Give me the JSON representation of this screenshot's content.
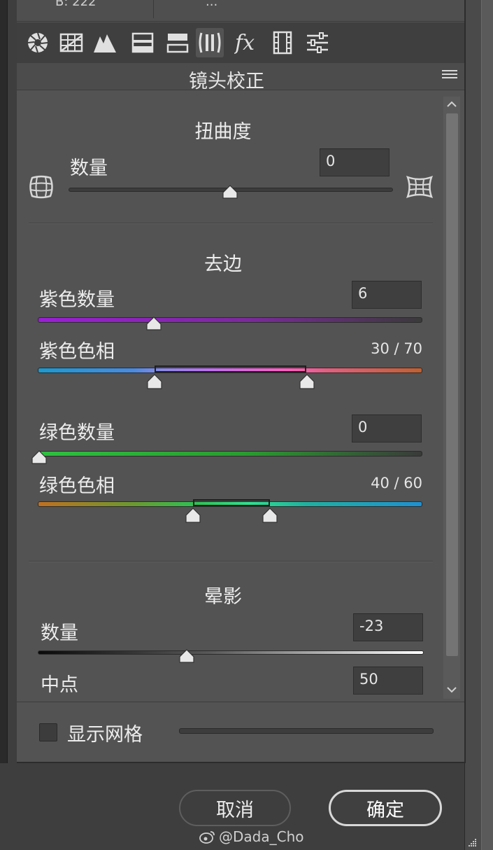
{
  "top_partial": {
    "left_text": "B: 222",
    "right_text": "..."
  },
  "header": {
    "title": "镜头校正"
  },
  "tabs": [
    {
      "icon": "aperture-icon"
    },
    {
      "icon": "grid-icon"
    },
    {
      "icon": "mountain-icon"
    },
    {
      "icon": "split-tone-icon"
    },
    {
      "icon": "hsl-icon"
    },
    {
      "icon": "lens-correction-icon"
    },
    {
      "icon": "fx-icon"
    },
    {
      "icon": "film-strip-icon"
    },
    {
      "icon": "sliders-icon"
    }
  ],
  "distortion": {
    "title": "扭曲度",
    "label": "数量",
    "value": "0",
    "level": 0.5
  },
  "defringe": {
    "title": "去边",
    "purple_amount": {
      "label": "紫色数量",
      "value": "6",
      "level": 0.3
    },
    "purple_hue": {
      "label": "紫色色相",
      "value": "30 / 70",
      "range": [
        30,
        70
      ]
    },
    "green_amount": {
      "label": "绿色数量",
      "value": "0",
      "level": 0
    },
    "green_hue": {
      "label": "绿色色相",
      "value": "40 / 60",
      "range": [
        40,
        60
      ]
    }
  },
  "vignette": {
    "title": "晕影",
    "amount": {
      "label": "数量",
      "value": "-23",
      "level": 0.385
    },
    "midpoint": {
      "label": "中点",
      "value": "50"
    }
  },
  "grid": {
    "label": "显示网格"
  },
  "buttons": {
    "cancel": "取消",
    "ok": "确定"
  },
  "watermark": "@Dada_Cho",
  "colors": {
    "panel": "#535353",
    "purple_track": "#a030d0",
    "green_track": "#30c040"
  }
}
